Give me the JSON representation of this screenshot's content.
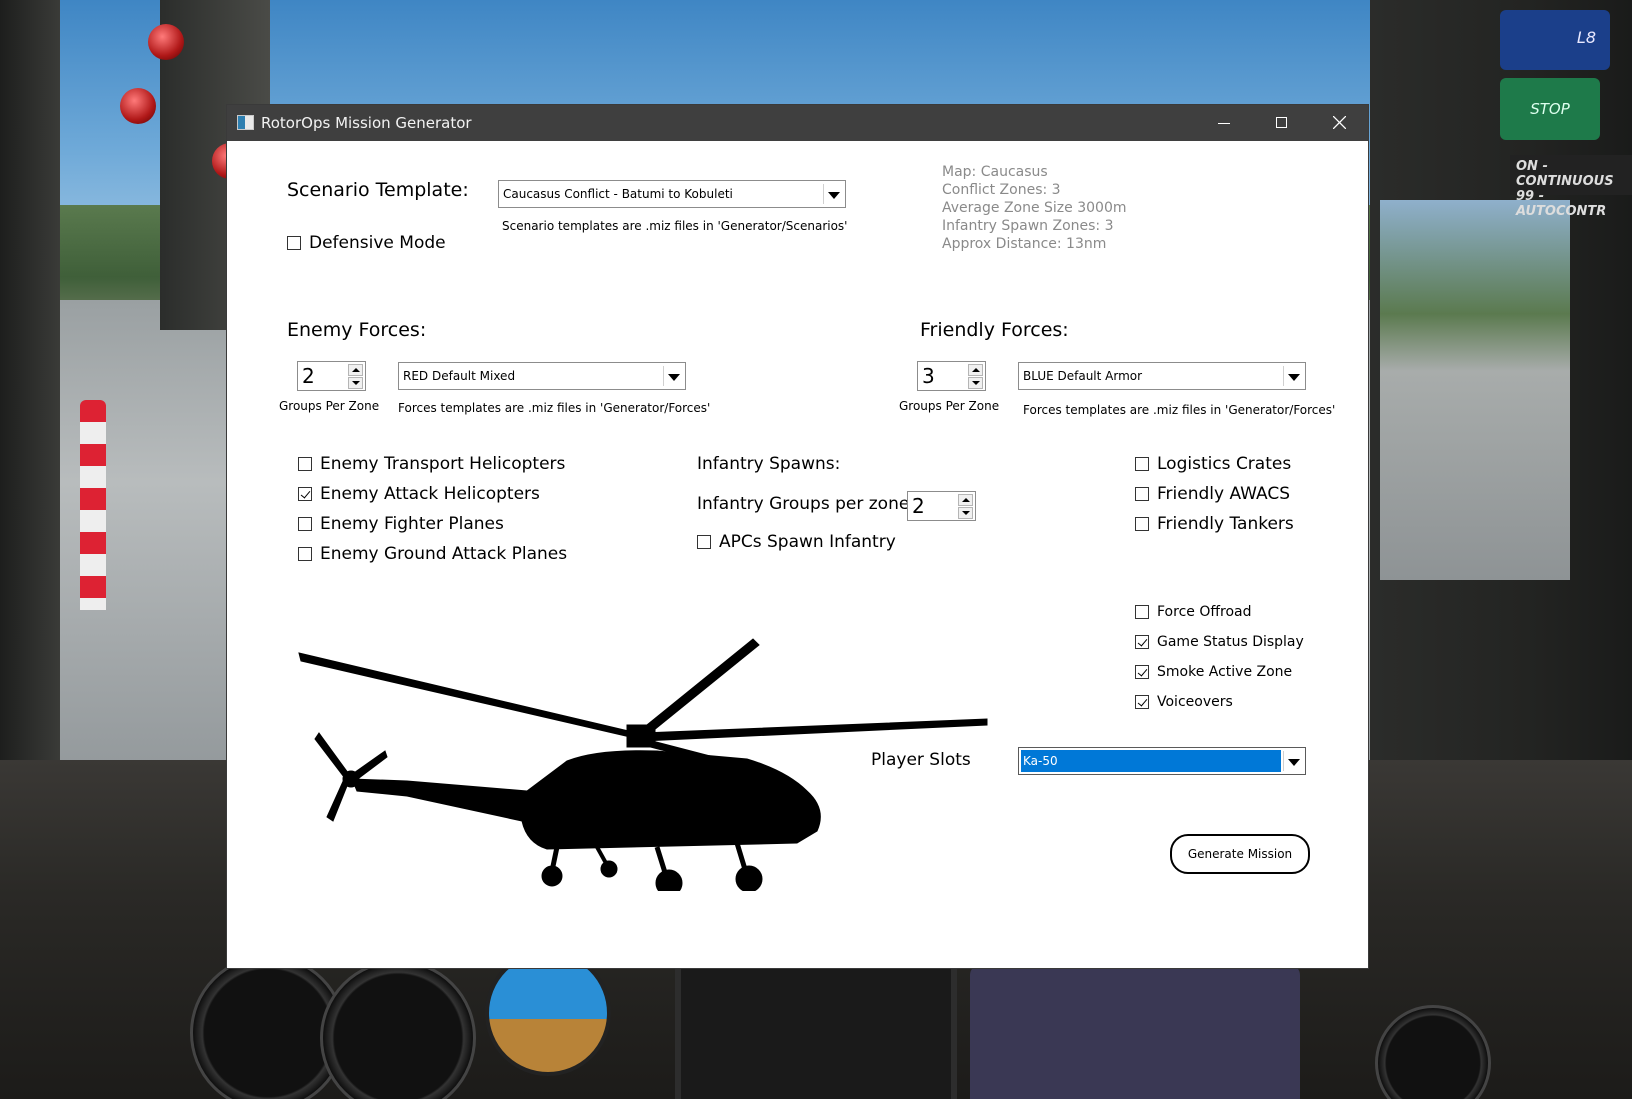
{
  "window": {
    "title": "RotorOps Mission Generator",
    "controls": {
      "minimize": "minimize",
      "maximize": "maximize",
      "close": "close"
    }
  },
  "scenario": {
    "label": "Scenario Template:",
    "selected": "Caucasus Conflict - Batumi to Kobuleti",
    "hint": "Scenario templates are .miz files in 'Generator/Scenarios'",
    "defensive_mode": {
      "label": "Defensive Mode",
      "checked": false
    }
  },
  "info": {
    "map": "Map: Caucasus",
    "conflict_zones": "Conflict Zones: 3",
    "avg_zone_size": "Average Zone Size 3000m",
    "infantry_spawn_zones": "Infantry Spawn Zones: 3",
    "approx_distance": "Approx Distance: 13nm"
  },
  "enemy": {
    "label": "Enemy Forces:",
    "groups": "2",
    "groups_label": "Groups Per Zone",
    "template": "RED Default Mixed",
    "hint": "Forces templates are .miz files in 'Generator/Forces'"
  },
  "friendly": {
    "label": "Friendly Forces:",
    "groups": "3",
    "groups_label": "Groups Per Zone",
    "template": "BLUE Default Armor",
    "hint": "Forces templates are .miz files in 'Generator/Forces'"
  },
  "enemy_options": [
    {
      "label": "Enemy Transport Helicopters",
      "checked": false
    },
    {
      "label": "Enemy Attack Helicopters",
      "checked": true
    },
    {
      "label": "Enemy Fighter Planes",
      "checked": false
    },
    {
      "label": "Enemy Ground Attack Planes",
      "checked": false
    }
  ],
  "infantry": {
    "title": "Infantry Spawns:",
    "groups_label": "Infantry Groups per zone:",
    "groups": "2",
    "apcs": {
      "label": "APCs Spawn Infantry",
      "checked": false
    }
  },
  "support_options": [
    {
      "label": "Logistics Crates",
      "checked": false
    },
    {
      "label": "Friendly AWACS",
      "checked": false
    },
    {
      "label": "Friendly Tankers",
      "checked": false
    }
  ],
  "game_options": [
    {
      "label": "Force Offroad",
      "checked": false
    },
    {
      "label": "Game Status Display",
      "checked": true
    },
    {
      "label": "Smoke Active Zone",
      "checked": true
    },
    {
      "label": "Voiceovers",
      "checked": true
    }
  ],
  "player_slots": {
    "label": "Player Slots",
    "selected": "Ka-50"
  },
  "generate_button": "Generate Mission",
  "background": {
    "button_l8": "L8",
    "button_stop": "STOP",
    "placard_line1": "ON - CONTINUOUS",
    "placard_line2": "99 - AUTOCONTR"
  },
  "colors": {
    "selection": "#0078d7",
    "titlebar": "#3f3f3f",
    "info_text": "#8a8a8a"
  }
}
